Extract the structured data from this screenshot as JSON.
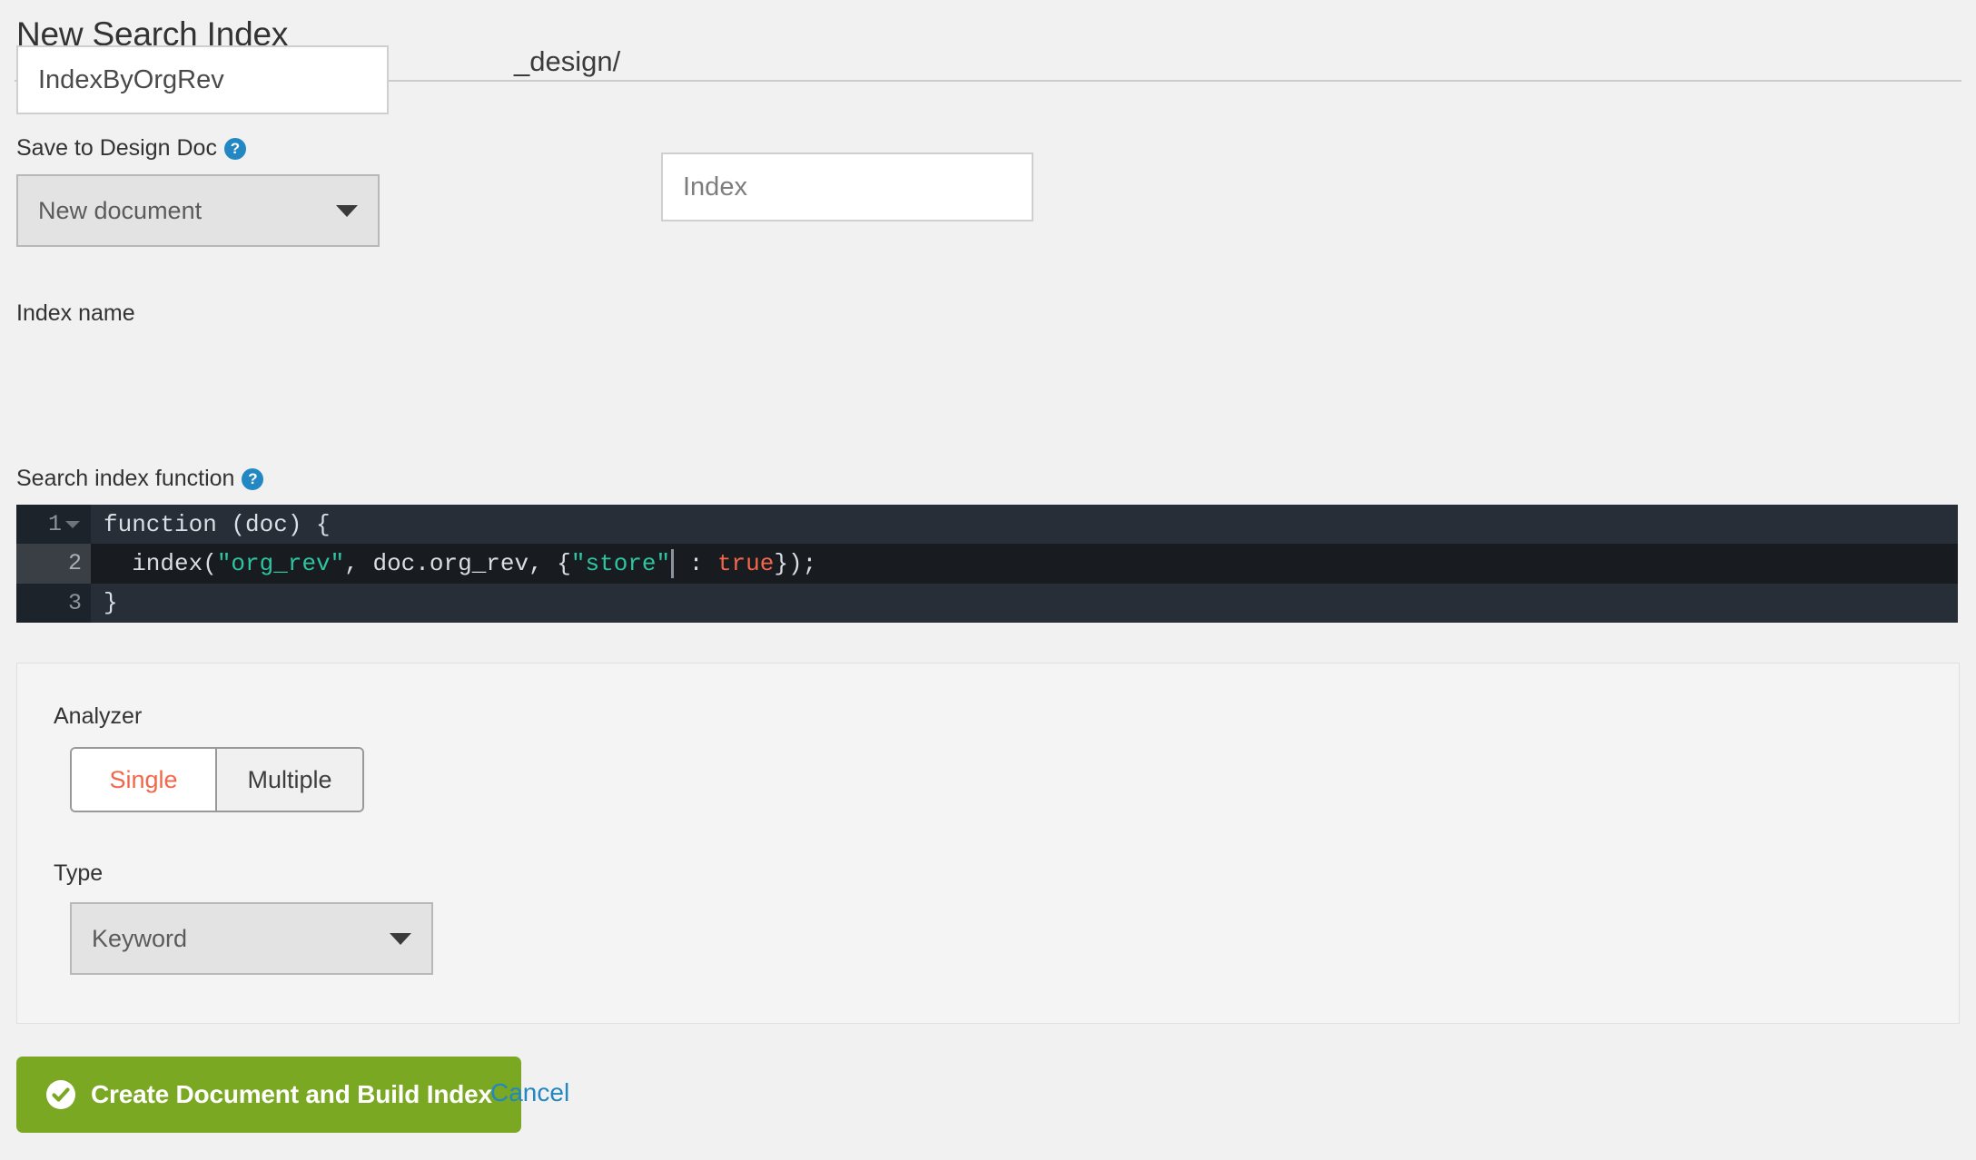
{
  "header": {
    "title": "New Search Index"
  },
  "design_doc": {
    "label": "Save to Design Doc",
    "help_icon": "question-mark-circle-icon",
    "select_value": "New document",
    "select_options": [
      "New document"
    ],
    "prefix": "_design/",
    "name_placeholder": "Index",
    "name_value": ""
  },
  "index_name": {
    "label": "Index name",
    "value": "IndexByOrgRev",
    "placeholder": ""
  },
  "search_function": {
    "label": "Search index function",
    "help_icon": "question-mark-circle-icon",
    "lines": [
      {
        "number": "1",
        "foldable": true,
        "active": false,
        "tokens": [
          {
            "text": "function (doc) {",
            "type": "plain"
          }
        ]
      },
      {
        "number": "2",
        "foldable": false,
        "active": true,
        "tokens": [
          {
            "text": "  index(",
            "type": "plain"
          },
          {
            "text": "\"org_rev\"",
            "type": "string"
          },
          {
            "text": ", doc.org_rev, {",
            "type": "plain"
          },
          {
            "text": "\"store\"",
            "type": "string"
          },
          {
            "text": "",
            "type": "cursor"
          },
          {
            "text": " : ",
            "type": "plain"
          },
          {
            "text": "true",
            "type": "bool"
          },
          {
            "text": "});",
            "type": "plain"
          }
        ]
      },
      {
        "number": "3",
        "foldable": false,
        "active": false,
        "tokens": [
          {
            "text": "}",
            "type": "plain"
          }
        ]
      }
    ]
  },
  "options": {
    "analyzer": {
      "label": "Analyzer",
      "buttons": [
        {
          "label": "Single",
          "active": true
        },
        {
          "label": "Multiple",
          "active": false
        }
      ]
    },
    "type": {
      "label": "Type",
      "value": "Keyword",
      "options": [
        "Keyword"
      ]
    }
  },
  "footer": {
    "submit_label": "Create Document and Build Index",
    "submit_icon": "check-circle-icon",
    "cancel_label": "Cancel"
  },
  "colors": {
    "page_background": "#f1f1f1",
    "primary_action": "#7ba822",
    "link": "#2287c2",
    "accent_selected": "#f2674a",
    "editor_background": "#272e37",
    "editor_active_line": "#181c21",
    "code_string": "#2ec4a0",
    "code_boolean": "#f2674a",
    "help_icon": "#2287c2"
  }
}
